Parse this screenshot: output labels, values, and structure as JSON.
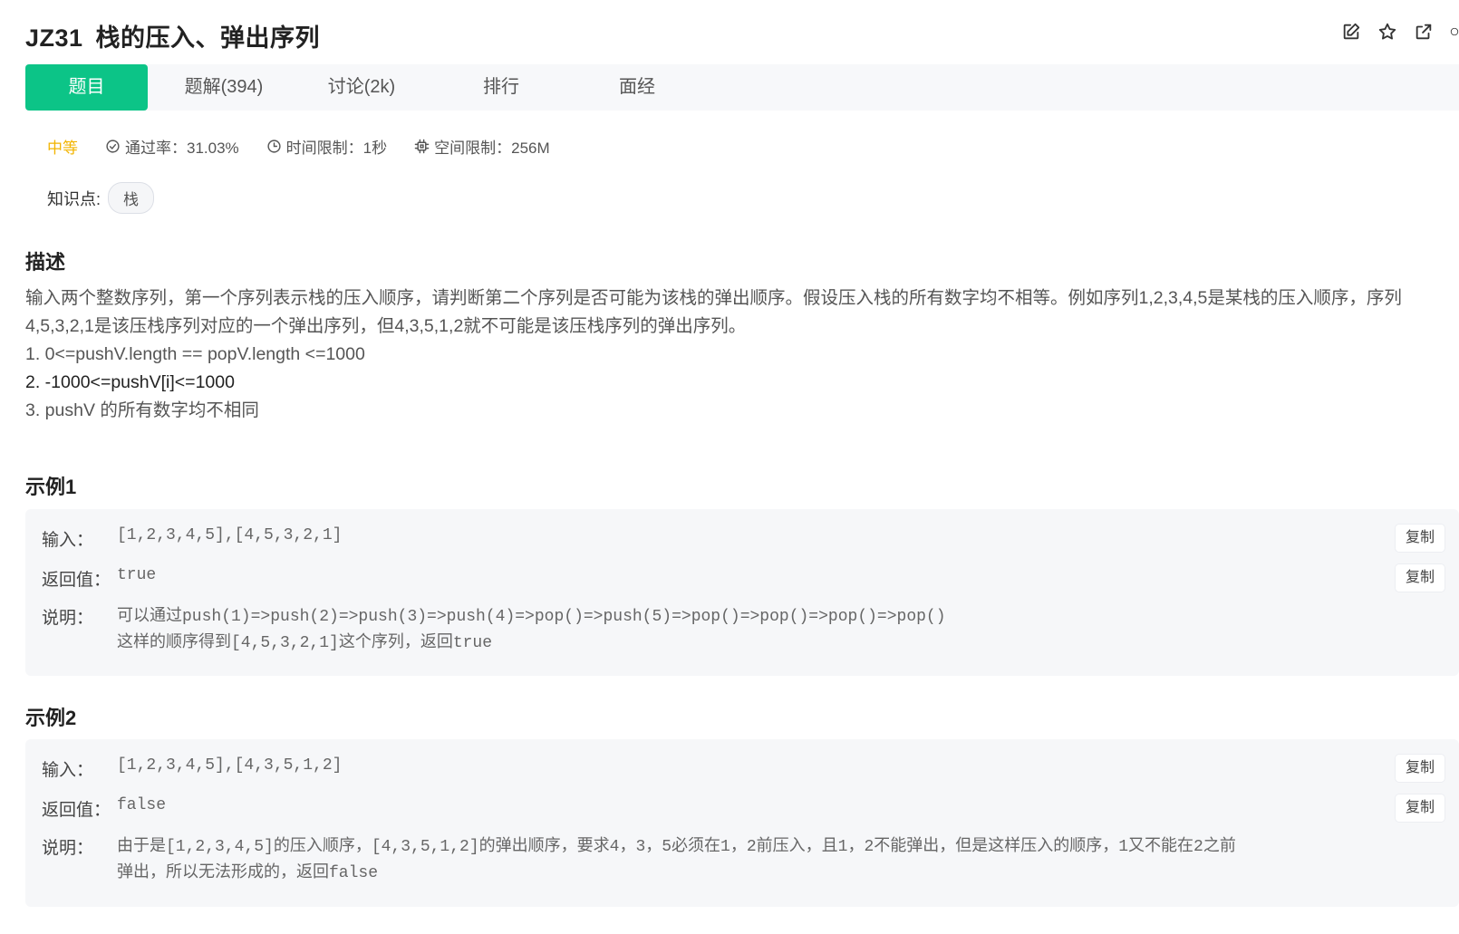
{
  "problem": {
    "code": "JZ31",
    "title": "栈的压入、弹出序列"
  },
  "toolbar": {
    "icons": [
      "edit-icon",
      "star-icon",
      "external-link-icon",
      "more-icon"
    ]
  },
  "tabs": [
    {
      "label": "题目",
      "active": true
    },
    {
      "label": "题解(394)"
    },
    {
      "label": "讨论(2k)"
    },
    {
      "label": "排行"
    },
    {
      "label": "面经"
    }
  ],
  "meta": {
    "difficulty": "中等",
    "pass_rate": "通过率：31.03%",
    "time_limit": "时间限制：1秒",
    "space_limit": "空间限制：256M"
  },
  "knowledge": {
    "label": "知识点:",
    "tag": "栈"
  },
  "description": {
    "heading": "描述",
    "text": "输入两个整数序列，第一个序列表示栈的压入顺序，请判断第二个序列是否可能为该栈的弹出顺序。假设压入栈的所有数字均不相等。例如序列1,2,3,4,5是某栈的压入顺序，序列4,5,3,2,1是该压栈序列对应的一个弹出序列，但4,3,5,1,2就不可能是该压栈序列的弹出序列。",
    "items": [
      "1. 0<=pushV.length == popV.length <=1000",
      "2. -1000<=pushV[i]<=1000",
      "3. pushV 的所有数字均不相同"
    ]
  },
  "examples": [
    {
      "heading": "示例1",
      "input_label": "输入：",
      "input": "[1,2,3,4,5],[4,5,3,2,1]",
      "return_label": "返回值：",
      "return": "true",
      "explain_label": "说明：",
      "explain_lines": [
        "可以通过push(1)=>push(2)=>push(3)=>push(4)=>pop()=>push(5)=>pop()=>pop()=>pop()=>pop()",
        "这样的顺序得到[4,5,3,2,1]这个序列，返回true"
      ],
      "copy_label": "复制"
    },
    {
      "heading": "示例2",
      "input_label": "输入：",
      "input": "[1,2,3,4,5],[4,3,5,1,2]",
      "return_label": "返回值：",
      "return": "false",
      "explain_label": "说明：",
      "explain_lines": [
        "由于是[1,2,3,4,5]的压入顺序，[4,3,5,1,2]的弹出顺序，要求4，3，5必须在1，2前压入，且1，2不能弹出，但是这样压入的顺序，1又不能在2之前",
        "弹出，所以无法形成的，返回false"
      ],
      "copy_label": "复制"
    }
  ],
  "colors": {
    "accent": "#0cc487",
    "difficulty": "#f2b400",
    "example_bg": "#f6f7f9",
    "tabbar_bg": "#f7f8fa"
  }
}
